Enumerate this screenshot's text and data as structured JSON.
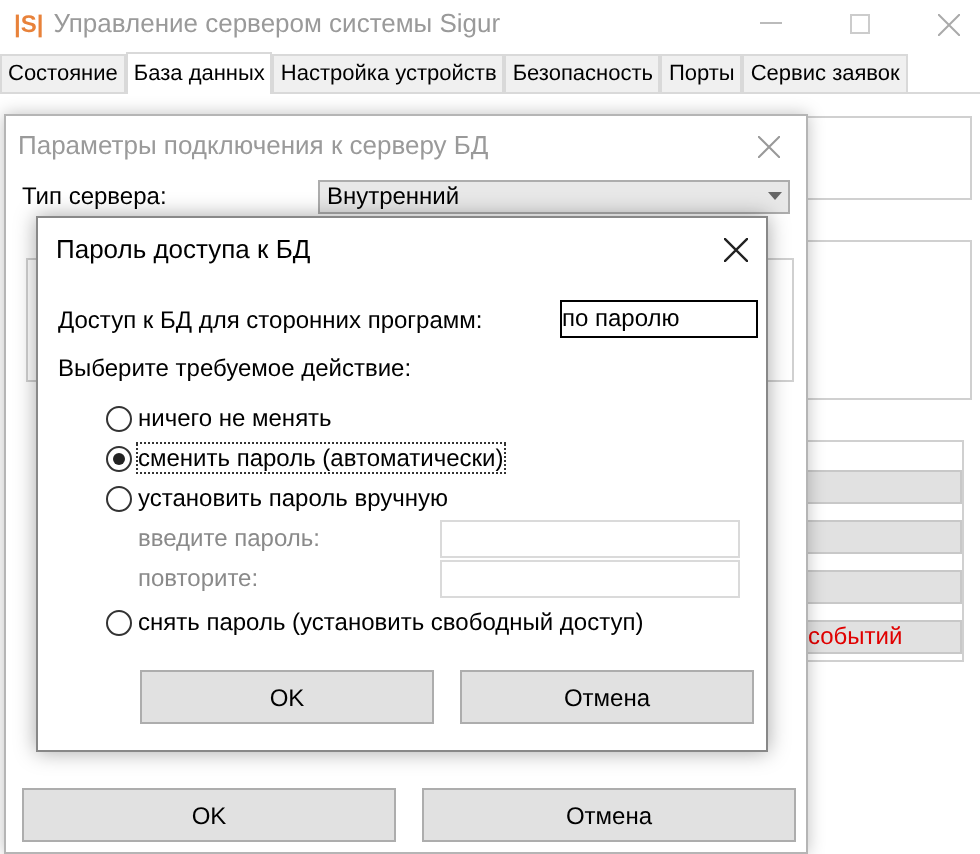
{
  "main_window": {
    "logo": "|S|",
    "title": "Управление сервером системы Sigur",
    "tabs": [
      {
        "label": "Состояние",
        "selected": false
      },
      {
        "label": "База данных",
        "selected": true
      },
      {
        "label": "Настройка устройств",
        "selected": false
      },
      {
        "label": "Безопасность",
        "selected": false
      },
      {
        "label": "Порты",
        "selected": false
      },
      {
        "label": "Сервис заявок",
        "selected": false
      }
    ],
    "side_button_text": "событий"
  },
  "connection_dialog": {
    "title": "Параметры подключения к серверу БД",
    "server_type_label": "Тип сервера:",
    "server_type_value": "Внутренний",
    "buttons": [
      "OK",
      "Отмена"
    ]
  },
  "password_dialog": {
    "title": "Пароль доступа к БД",
    "access_label": "Доступ к БД для сторонних программ:",
    "access_value": "по паролю",
    "action_prompt": "Выберите требуемое действие:",
    "options": [
      {
        "label": "ничего не менять",
        "selected": false
      },
      {
        "label": "сменить пароль (автоматически)",
        "selected": true
      },
      {
        "label": "установить пароль вручную",
        "selected": false
      },
      {
        "label": "снять пароль (установить свободный доступ)",
        "selected": false
      }
    ],
    "manual_fields": {
      "disabled": true,
      "password_label": "введите пароль:",
      "repeat_label": "повторите:"
    },
    "buttons": [
      "OK",
      "Отмена"
    ]
  }
}
